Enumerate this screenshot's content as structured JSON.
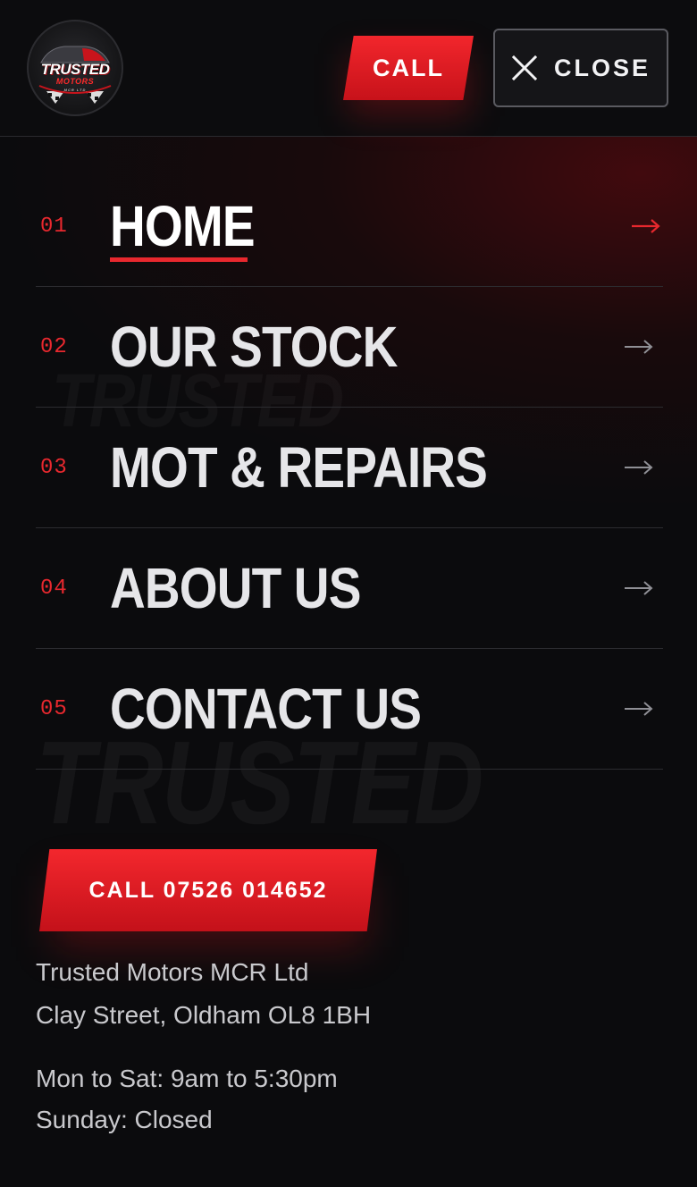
{
  "header": {
    "logo": {
      "line1": "TRUSTED",
      "line2": "MOTORS",
      "line3": "MCR LTD"
    },
    "call_label": "CALL",
    "close_label": "CLOSE"
  },
  "nav": {
    "items": [
      {
        "number": "01",
        "label": "HOME",
        "active": true
      },
      {
        "number": "02",
        "label": "OUR STOCK",
        "active": false
      },
      {
        "number": "03",
        "label": "MOT & REPAIRS",
        "active": false
      },
      {
        "number": "04",
        "label": "ABOUT US",
        "active": false
      },
      {
        "number": "05",
        "label": "CONTACT US",
        "active": false
      }
    ]
  },
  "cta": {
    "label": "CALL 07526 014652"
  },
  "info": {
    "company": "Trusted Motors MCR Ltd",
    "address": "Clay Street, Oldham OL8 1BH",
    "hours_weekday": "Mon to Sat: 9am to 5:30pm",
    "hours_sunday": "Sunday: Closed"
  },
  "colors": {
    "accent": "#e8282e",
    "background": "#0b0b0d",
    "text": "#e6e6e9"
  }
}
